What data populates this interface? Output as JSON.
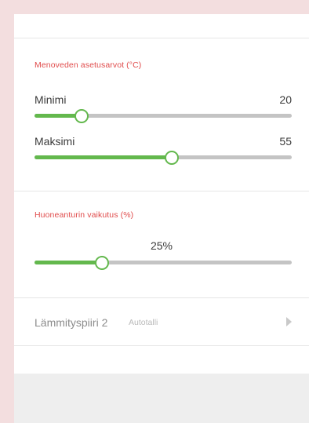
{
  "supply_setpoints": {
    "title": "Menoveden asetusarvot (°C)",
    "minimum": {
      "label": "Minimi",
      "value": "20",
      "level": 0.18
    },
    "maximum": {
      "label": "Maksimi",
      "value": "55",
      "level": 0.53
    }
  },
  "room_sensor": {
    "title": "Huoneanturin vaikutus (%)",
    "value": "25%",
    "level": 0.26
  },
  "circuit_row": {
    "name": "Lämmityspiiri 2",
    "sub": "Autotalli",
    "chevron_icon": "chevron-right-icon"
  },
  "colors": {
    "accent": "#63b84d",
    "section_title": "#e04b4b",
    "track": "#c4c4c4"
  }
}
